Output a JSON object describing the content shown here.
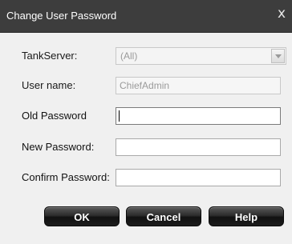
{
  "window": {
    "title": "Change User Password",
    "close_glyph": "x"
  },
  "form": {
    "tankserver_label": "TankServer:",
    "tankserver_value": "(All)",
    "username_label": "User name:",
    "username_value": "ChiefAdmin",
    "old_password_label": "Old Password",
    "old_password_value": "",
    "new_password_label": "New Password:",
    "new_password_value": "",
    "confirm_password_label": "Confirm Password:",
    "confirm_password_value": ""
  },
  "buttons": {
    "ok": "OK",
    "cancel": "Cancel",
    "help": "Help"
  },
  "icons": {
    "dropdown": "chevron-down-icon",
    "close": "close-icon"
  }
}
